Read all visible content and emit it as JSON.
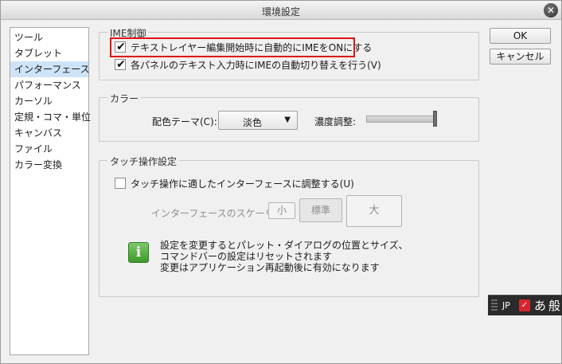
{
  "window": {
    "title": "環境設定",
    "close_glyph": "✕"
  },
  "sidebar": {
    "items": [
      {
        "label": "ツール"
      },
      {
        "label": "タブレット"
      },
      {
        "label": "インターフェース"
      },
      {
        "label": "パフォーマンス"
      },
      {
        "label": "カーソル"
      },
      {
        "label": "定規・コマ・単位"
      },
      {
        "label": "キャンバス"
      },
      {
        "label": "ファイル"
      },
      {
        "label": "カラー変換"
      }
    ],
    "selected": "インターフェース"
  },
  "ime_group": {
    "title": "IME制御",
    "option1": {
      "label": "テキストレイヤー編集開始時に自動的にIMEをONにする",
      "checked": true
    },
    "option2": {
      "label": "各パネルのテキスト入力時にIMEの自動切り替えを行う(V)",
      "checked": true
    },
    "highlight_color": "#e01414"
  },
  "color_group": {
    "title": "カラー",
    "theme_label": "配色テーマ(C):",
    "theme_value": "淡色",
    "density_label": "濃度調整:",
    "density_level": 1.0
  },
  "touch_group": {
    "title": "タッチ操作設定",
    "option": {
      "label": "タッチ操作に適したインターフェースに調整する(U)",
      "checked": false
    },
    "scaling_label": "インターフェースのスケーリング:",
    "scale_small": "小",
    "scale_standard": "標準",
    "scale_large": "大",
    "info_lines": [
      "設定を変更するとパレット・ダイアログの位置とサイズ、",
      "コマンドバーの設定はリセットされます",
      "変更はアプリケーション再起動後に有効になります"
    ]
  },
  "buttons": {
    "ok": "OK",
    "cancel": "キャンセル"
  },
  "ime_bar": {
    "mode": "JP",
    "input": "あ",
    "kanji": "般"
  },
  "icons": {
    "close": "close-icon",
    "check": "checkmark-icon",
    "dropdown": "chevron-down-icon",
    "info": "info-icon"
  }
}
